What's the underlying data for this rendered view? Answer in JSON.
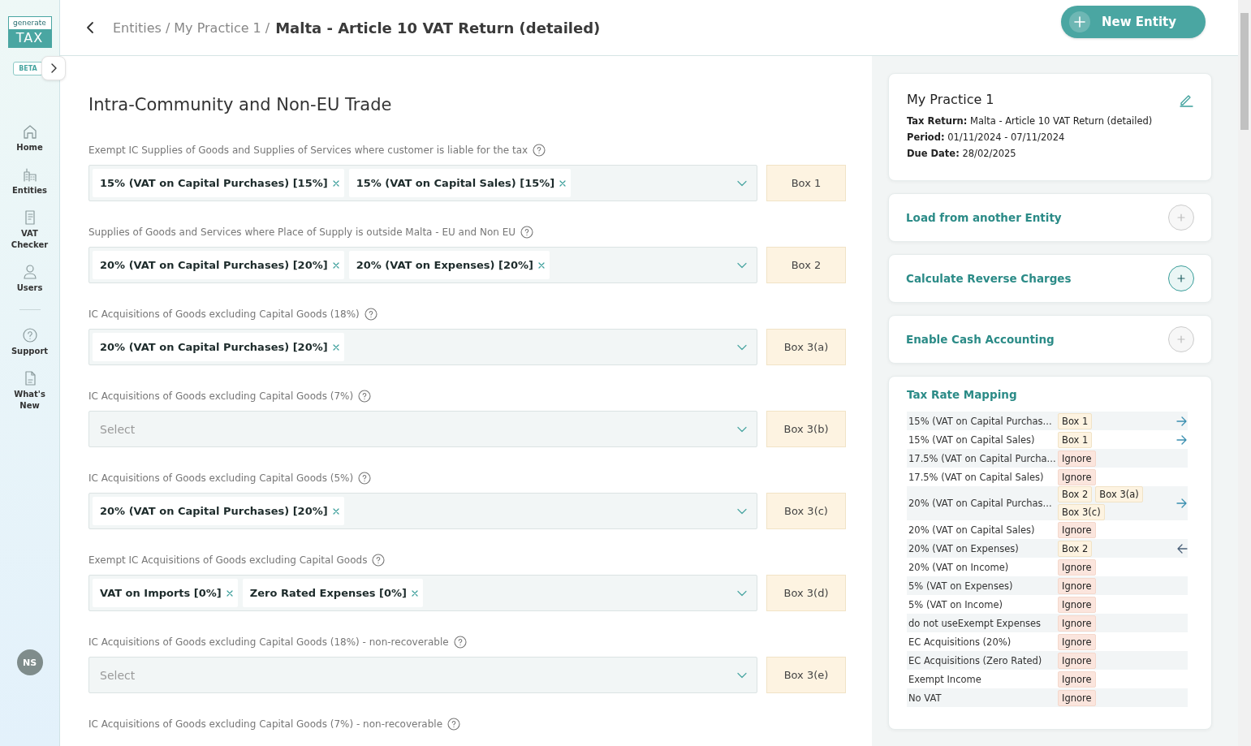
{
  "sidebar": {
    "logo": {
      "top": "generate",
      "bottom": "TAX"
    },
    "badge": "BETA",
    "items": [
      {
        "label": "Home",
        "divider_before": false
      },
      {
        "label": "Entities",
        "divider_before": false
      },
      {
        "label": "VAT Checker",
        "divider_before": false
      },
      {
        "label": "Users",
        "divider_before": false
      },
      {
        "label": "Support",
        "divider_before": true
      },
      {
        "label": "What's New",
        "divider_before": false
      }
    ],
    "avatar": "NS"
  },
  "header": {
    "breadcrumb": [
      {
        "label": "Entities",
        "separator": "/"
      },
      {
        "label": "My Practice 1",
        "separator": "/"
      }
    ],
    "title": "Malta - Article 10 VAT Return (detailed)",
    "button": "New Entity"
  },
  "section": {
    "title": "Intra-Community and Non-EU Trade",
    "fields": [
      {
        "label": "Exempt IC Supplies of Goods and Supplies of Services where customer is liable for the tax",
        "tags": [
          "15% (VAT on Capital Purchases) [15%]",
          "15% (VAT on Capital Sales) [15%]"
        ],
        "box": "Box 1"
      },
      {
        "label": "Supplies of Goods and Services where Place of Supply is outside Malta - EU and Non EU",
        "tags": [
          "20% (VAT on Capital Purchases) [20%]",
          "20% (VAT on Expenses) [20%]"
        ],
        "box": "Box 2"
      },
      {
        "label": "IC Acquisitions of Goods excluding Capital Goods (18%)",
        "tags": [
          "20% (VAT on Capital Purchases) [20%]"
        ],
        "box": "Box 3(a)"
      },
      {
        "label": "IC Acquisitions of Goods excluding Capital Goods (7%)",
        "placeholder": "Select",
        "box": "Box 3(b)"
      },
      {
        "label": "IC Acquisitions of Goods excluding Capital Goods (5%)",
        "tags": [
          "20% (VAT on Capital Purchases) [20%]"
        ],
        "box": "Box 3(c)"
      },
      {
        "label": "Exempt IC Acquisitions of Goods excluding Capital Goods",
        "tags": [
          "VAT on Imports [0%]",
          "Zero Rated Expenses [0%]"
        ],
        "box": "Box 3(d)"
      },
      {
        "label": "IC Acquisitions of Goods excluding Capital Goods (18%) - non-recoverable",
        "placeholder": "Select",
        "box": "Box 3(e)"
      },
      {
        "label": "IC Acquisitions of Goods excluding Capital Goods (7%) - non-recoverable"
      }
    ]
  },
  "summary": {
    "title": "My Practice 1",
    "lines": [
      {
        "key": "Tax Return:",
        "value": "Malta - Article 10 VAT Return (detailed)"
      },
      {
        "key": "Period:",
        "value": "01/11/2024 - 07/11/2024"
      },
      {
        "key": "Due Date:",
        "value": "28/02/2025"
      }
    ]
  },
  "actions": [
    {
      "label": "Load from another Entity",
      "active": false
    },
    {
      "label": "Calculate Reverse Charges",
      "active": true
    },
    {
      "label": "Enable Cash Accounting",
      "active": false
    }
  ],
  "mapping": {
    "title": "Tax Rate Mapping",
    "rows": [
      {
        "rate": "15% (VAT on Capital Purchas...",
        "targets": [
          {
            "label": "Box 1",
            "kind": "box"
          }
        ],
        "kind": "outgoing"
      },
      {
        "rate": "15% (VAT on Capital Sales)",
        "targets": [
          {
            "label": "Box 1",
            "kind": "box"
          }
        ],
        "kind": "outgoing"
      },
      {
        "rate": "17.5% (VAT on Capital Purcha...",
        "targets": [
          {
            "label": "Ignore",
            "kind": "ignore"
          }
        ],
        "kind": "plain"
      },
      {
        "rate": "17.5% (VAT on Capital Sales)",
        "targets": [
          {
            "label": "Ignore",
            "kind": "ignore"
          }
        ],
        "kind": "plain"
      },
      {
        "rate": "20% (VAT on Capital Purchas...",
        "targets": [
          {
            "label": "Box 2",
            "kind": "box"
          },
          {
            "label": "Box 3(a)",
            "kind": "box"
          },
          {
            "label": "Box 3(c)",
            "kind": "box"
          }
        ],
        "kind": "outgoing"
      },
      {
        "rate": "20% (VAT on Capital Sales)",
        "targets": [
          {
            "label": "Ignore",
            "kind": "ignore"
          }
        ],
        "kind": "plain"
      },
      {
        "rate": "20% (VAT on Expenses)",
        "targets": [
          {
            "label": "Box 2",
            "kind": "box"
          }
        ],
        "kind": "incoming"
      },
      {
        "rate": "20% (VAT on Income)",
        "targets": [
          {
            "label": "Ignore",
            "kind": "ignore"
          }
        ],
        "kind": "plain"
      },
      {
        "rate": "5% (VAT on Expenses)",
        "targets": [
          {
            "label": "Ignore",
            "kind": "ignore"
          }
        ],
        "kind": "plain"
      },
      {
        "rate": "5% (VAT on Income)",
        "targets": [
          {
            "label": "Ignore",
            "kind": "ignore"
          }
        ],
        "kind": "plain"
      },
      {
        "rate": "do not useExempt Expenses",
        "targets": [
          {
            "label": "Ignore",
            "kind": "ignore"
          }
        ],
        "kind": "plain"
      },
      {
        "rate": "EC Acquisitions (20%)",
        "targets": [
          {
            "label": "Ignore",
            "kind": "ignore"
          }
        ],
        "kind": "plain"
      },
      {
        "rate": "EC Acquisitions (Zero Rated)",
        "targets": [
          {
            "label": "Ignore",
            "kind": "ignore"
          }
        ],
        "kind": "plain"
      },
      {
        "rate": "Exempt Income",
        "targets": [
          {
            "label": "Ignore",
            "kind": "ignore"
          }
        ],
        "kind": "plain"
      },
      {
        "rate": "No VAT",
        "targets": [
          {
            "label": "Ignore",
            "kind": "ignore"
          }
        ],
        "kind": "plain"
      }
    ]
  }
}
